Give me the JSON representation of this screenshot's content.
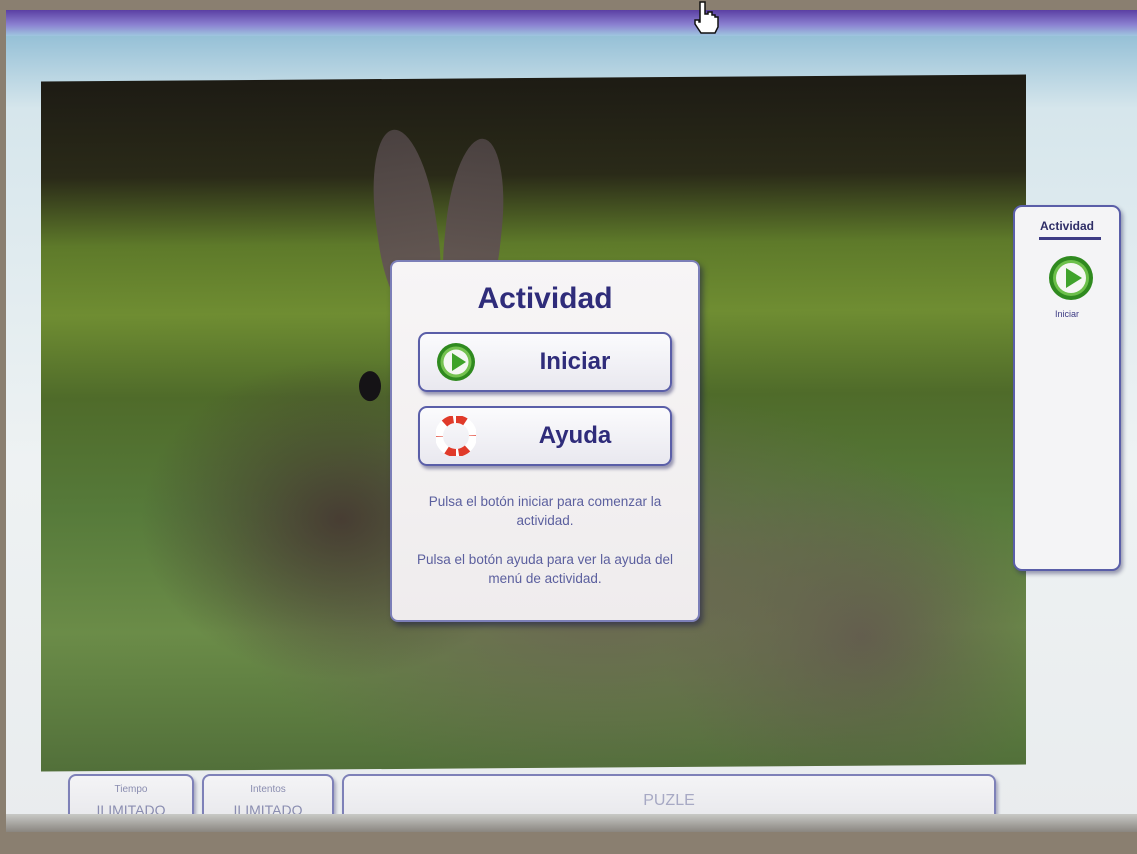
{
  "dialog": {
    "title": "Actividad",
    "start_button": {
      "label": "Iniciar",
      "icon": "play-icon"
    },
    "help_button": {
      "label": "Ayuda",
      "icon": "lifebuoy-icon"
    },
    "text_start": "Pulsa el botón iniciar para comenzar la actividad.",
    "text_help": "Pulsa el botón ayuda para ver la ayuda del menú de actividad."
  },
  "side_panel": {
    "title": "Actividad",
    "start_label": "Iniciar",
    "start_icon": "play-icon"
  },
  "status_bar": {
    "time": {
      "caption": "Tiempo",
      "value": "ILIMITADO"
    },
    "attempts": {
      "caption": "Intentos",
      "value": "ILIMITADO"
    },
    "activity_name": "PUZLE"
  },
  "colors": {
    "accent": "#2f2c7a",
    "border": "#5a5ea8",
    "play_green": "#3fa32a"
  },
  "icons": {
    "cursor": "hand-pointer-icon"
  }
}
